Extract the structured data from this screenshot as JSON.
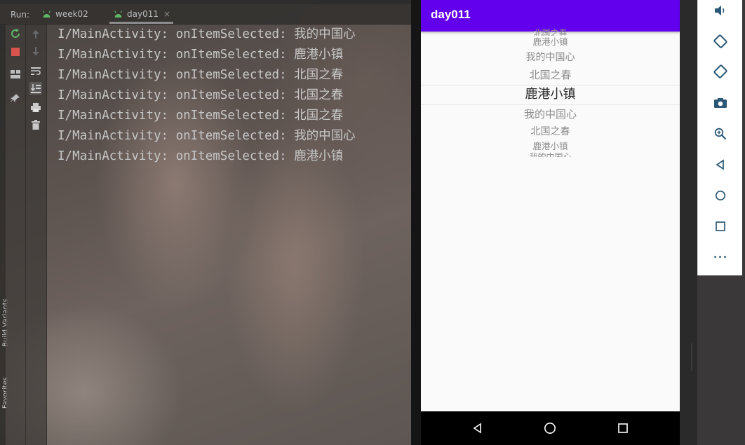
{
  "ide": {
    "run_label": "Run:",
    "tabs": [
      {
        "label": "week02",
        "icon": "android-icon"
      },
      {
        "label": "day011",
        "icon": "android-icon",
        "close": "×"
      }
    ],
    "sidebar_labels": [
      "Build Variants",
      "Favorites"
    ],
    "console_lines": [
      "I/MainActivity: onItemSelected: 我的中国心",
      "I/MainActivity: onItemSelected: 鹿港小镇",
      "I/MainActivity: onItemSelected: 北国之春",
      "I/MainActivity: onItemSelected: 北国之春",
      "I/MainActivity: onItemSelected: 北国之春",
      "I/MainActivity: onItemSelected: 我的中国心",
      "I/MainActivity: onItemSelected: 鹿港小镇"
    ],
    "toolbar_icons": [
      "rerun-icon",
      "stop-icon",
      "layout-icon",
      "pin-icon",
      "up-arrow-icon",
      "down-arrow-icon",
      "soft-wrap-icon",
      "scroll-to-end-icon",
      "print-icon",
      "trash-icon"
    ]
  },
  "app": {
    "title": "day011",
    "accent": "#6200ee",
    "picker": {
      "items": [
        "北国之春",
        "鹿港小镇",
        "我的中国心",
        "北国之春",
        "鹿港小镇",
        "我的中国心",
        "北国之春",
        "鹿港小镇",
        "我的中国心"
      ],
      "selected_index": 4
    }
  },
  "navbar": {
    "icons": [
      "back-icon",
      "home-icon",
      "recents-icon"
    ]
  },
  "emulator_toolbar": {
    "icons": [
      "volume-icon",
      "rotate-left-icon",
      "rotate-right-icon",
      "camera-icon",
      "zoom-icon",
      "back-icon",
      "home-icon",
      "overview-icon",
      "more-icon"
    ],
    "more_label": "•••"
  }
}
